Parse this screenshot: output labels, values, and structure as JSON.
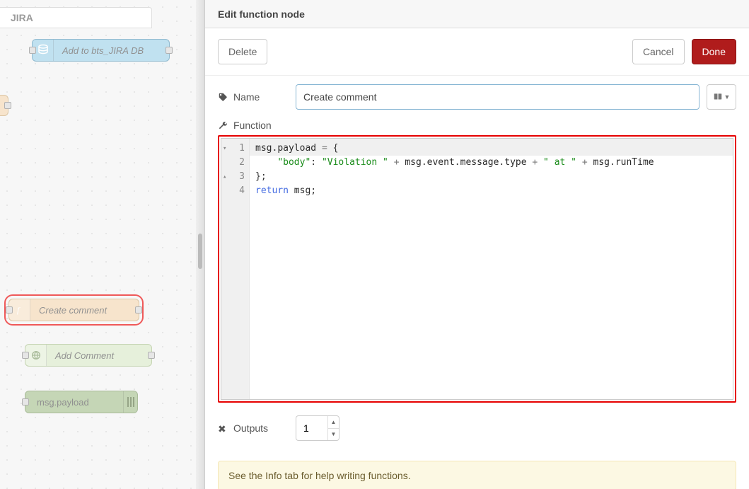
{
  "canvas": {
    "tab_label": "JIRA",
    "nodes": {
      "db": {
        "label": "Add to bts_JIRA DB"
      },
      "fn": {
        "label": "Create comment"
      },
      "http": {
        "label": "Add Comment"
      },
      "debug": {
        "label": "msg.payload"
      }
    }
  },
  "panel": {
    "title": "Edit function node",
    "buttons": {
      "delete": "Delete",
      "cancel": "Cancel",
      "done": "Done"
    },
    "name": {
      "label": "Name",
      "value": "Create comment"
    },
    "function": {
      "label": "Function",
      "lines": [
        {
          "n": "1",
          "fold": "▾",
          "html": "<span class='tok-id'>msg</span>.<span class='tok-id'>payload</span> <span class='tok-op'>=</span> {"
        },
        {
          "n": "2",
          "fold": "",
          "html": "    <span class='tok-str'>\"body\"</span>: <span class='tok-str'>\"Violation \"</span> <span class='tok-op'>+</span> <span class='tok-id'>msg</span>.<span class='tok-id'>event</span>.<span class='tok-id'>message</span>.<span class='tok-id'>type</span> <span class='tok-op'>+</span> <span class='tok-str'>\" at \"</span> <span class='tok-op'>+</span> <span class='tok-id'>msg</span>.<span class='tok-id'>runTime</span>"
        },
        {
          "n": "3",
          "fold": "▴",
          "html": "};"
        },
        {
          "n": "4",
          "fold": "",
          "html": "<span class='tok-kw'>return</span> <span class='tok-id'>msg</span>;"
        }
      ]
    },
    "outputs": {
      "label": "Outputs",
      "value": "1"
    },
    "info_text": "See the Info tab for help writing functions."
  }
}
